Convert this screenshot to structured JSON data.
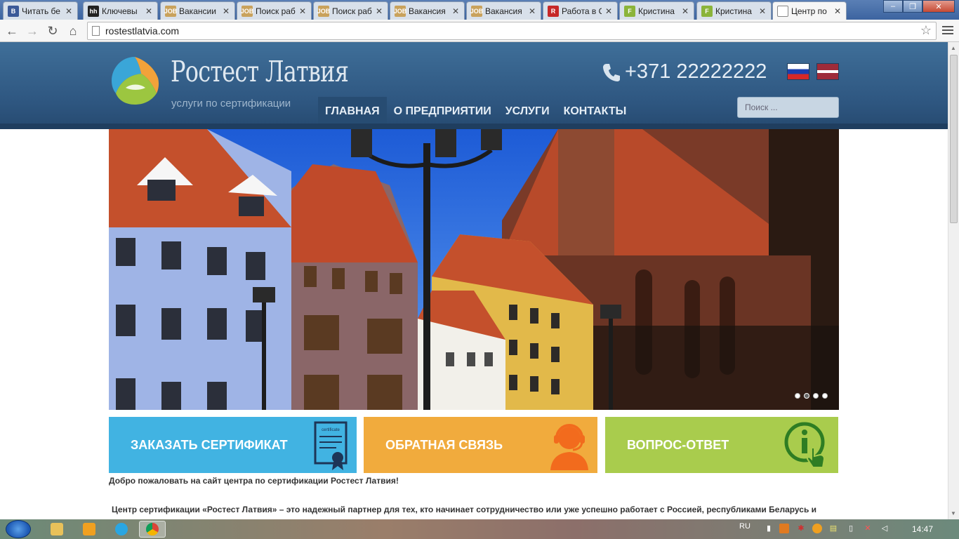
{
  "browser": {
    "tabs": [
      {
        "icon": "B",
        "icon_color": "#3b5998",
        "title": "Читать бе",
        "active": false
      },
      {
        "icon": "hh",
        "icon_color": "#222222",
        "title": "Ключевы",
        "active": false
      },
      {
        "icon": "JOB",
        "icon_color": "#c9a25c",
        "title": "Вакансии",
        "active": false
      },
      {
        "icon": "JOB",
        "icon_color": "#c9a25c",
        "title": "Поиск раб",
        "active": false
      },
      {
        "icon": "JOB",
        "icon_color": "#c9a25c",
        "title": "Поиск раб",
        "active": false
      },
      {
        "icon": "JOB",
        "icon_color": "#c9a25c",
        "title": "Вакансия",
        "active": false
      },
      {
        "icon": "JOB",
        "icon_color": "#c9a25c",
        "title": "Вакансия",
        "active": false
      },
      {
        "icon": "R",
        "icon_color": "#c62828",
        "title": "Работа в С",
        "active": false
      },
      {
        "icon": "F",
        "icon_color": "#8bb43a",
        "title": "Кристина",
        "active": false
      },
      {
        "icon": "F",
        "icon_color": "#8bb43a",
        "title": "Кристина",
        "active": false
      },
      {
        "icon": "",
        "icon_color": "#ffffff",
        "title": "Центр по",
        "active": true
      }
    ],
    "url": "rostestlatvia.com"
  },
  "site": {
    "logo_title": "Ростест Латвия",
    "logo_subtitle": "услуги по сертификации",
    "phone": "+371 22222222",
    "nav": [
      {
        "label": "ГЛАВНАЯ",
        "active": true
      },
      {
        "label": "О ПРЕДПРИЯТИИ",
        "active": false
      },
      {
        "label": "УСЛУГИ",
        "active": false
      },
      {
        "label": "КОНТАКТЫ",
        "active": false
      }
    ],
    "search_placeholder": "Поиск ...",
    "slider": {
      "slides": 4,
      "active_index": 1
    },
    "cta": [
      {
        "label": "ЗАКАЗАТЬ СЕРТИФИКАТ",
        "icon": "certificate-icon",
        "icon_text": "certificate",
        "color": "#41b3e2"
      },
      {
        "label": "ОБРАТНАЯ СВЯЗЬ",
        "icon": "headset-operator-icon",
        "color": "#f1ab3d"
      },
      {
        "label": "ВОПРОС-ОТВЕТ",
        "icon": "info-touch-icon",
        "color": "#a9cc4d"
      }
    ],
    "welcome": "Добро пожаловать на сайт центра по сертификации Ростест Латвия!",
    "intro": "Центр сертификации «Ростест Латвия» – это надежный партнер для тех, кто начинает сотрудничество или уже успешно работает с Россией, республиками Беларусь и"
  },
  "taskbar": {
    "language": "RU",
    "time": "14:47"
  }
}
